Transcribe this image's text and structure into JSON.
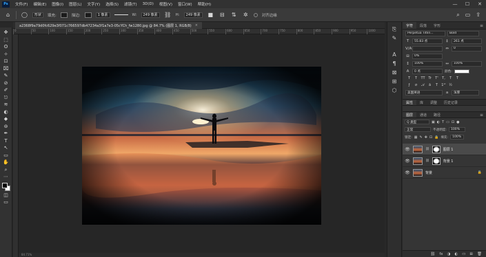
{
  "app": {
    "logo": "Ps"
  },
  "menu": [
    "文件(F)",
    "编辑(E)",
    "图像(I)",
    "图层(L)",
    "文字(Y)",
    "选择(S)",
    "滤镜(T)",
    "3D(D)",
    "视图(V)",
    "窗口(W)",
    "帮助(H)"
  ],
  "window_controls": {
    "minimize": "—",
    "maximize": "☐",
    "close": "✕"
  },
  "options": {
    "shape_mode": "形状",
    "fill_label": "填充:",
    "stroke_label": "描边:",
    "stroke_width": "1 像素",
    "w_label": "W:",
    "w_value": "249 像素",
    "h_label": "H:",
    "h_value": "249 像素",
    "align_edges": "对齐边缘"
  },
  "document": {
    "tab_title": "a2368f9a79d0fc629e3f071c766597db47234a3f1a7e3-05cYCh_fw1280.jpg @ 84.7% (图层 1, RGB/8)",
    "tab_close": "×",
    "status": "84.71%",
    "ruler_marks": [
      "0",
      "50",
      "100",
      "150",
      "200",
      "250",
      "300",
      "350",
      "400",
      "450",
      "500",
      "550",
      "600",
      "650",
      "700",
      "750",
      "800",
      "850",
      "900",
      "950",
      "1000"
    ]
  },
  "tools": [
    "✥",
    "⬚",
    "ʘ",
    "✧",
    "⊡",
    "⌧",
    "✎",
    "⊘",
    "✐",
    "⎋",
    "≋",
    "◐",
    "◆",
    "⊚",
    "✒",
    "T",
    "↖",
    "▭",
    "✋",
    "⌕",
    "⋯"
  ],
  "character_panel": {
    "tabs": [
      "字符",
      "段落",
      "字形"
    ],
    "font_family": "Perpetua Titlin...",
    "font_style": "Bold",
    "font_size": "55.83 点",
    "leading": "261 点",
    "tracking_label": "V/A",
    "tracking_value": "0",
    "kerning_value": "0%",
    "vscale": "100%",
    "hscale": "100%",
    "baseline": "0 点",
    "color_label": "颜色:",
    "format_buttons": [
      "T",
      "T",
      "TT",
      "Tr",
      "T'",
      "T,",
      "T",
      "T"
    ],
    "lang": "美国英语",
    "aa": "a",
    "aa_mode": "浑厚"
  },
  "properties_tabs": [
    "属性",
    "库",
    "调整",
    "历史记录"
  ],
  "layers_panel": {
    "tabs": [
      "图层",
      "通道",
      "路径"
    ],
    "filter_kind": "Q 类型",
    "blend_mode": "正常",
    "opacity_label": "不透明度:",
    "opacity_value": "100%",
    "lock_label": "锁定:",
    "fill_label": "填充:",
    "fill_value": "100%",
    "layers": [
      {
        "name": "图层 1",
        "selected": true,
        "has_mask": true,
        "locked": false
      },
      {
        "name": "背景 1",
        "selected": false,
        "has_mask": true,
        "locked": false
      },
      {
        "name": "背景",
        "selected": false,
        "has_mask": false,
        "locked": true
      }
    ],
    "footer_icons": [
      "⛓",
      "fx",
      "◑",
      "◐",
      "▭",
      "⊞",
      "🗑"
    ]
  }
}
